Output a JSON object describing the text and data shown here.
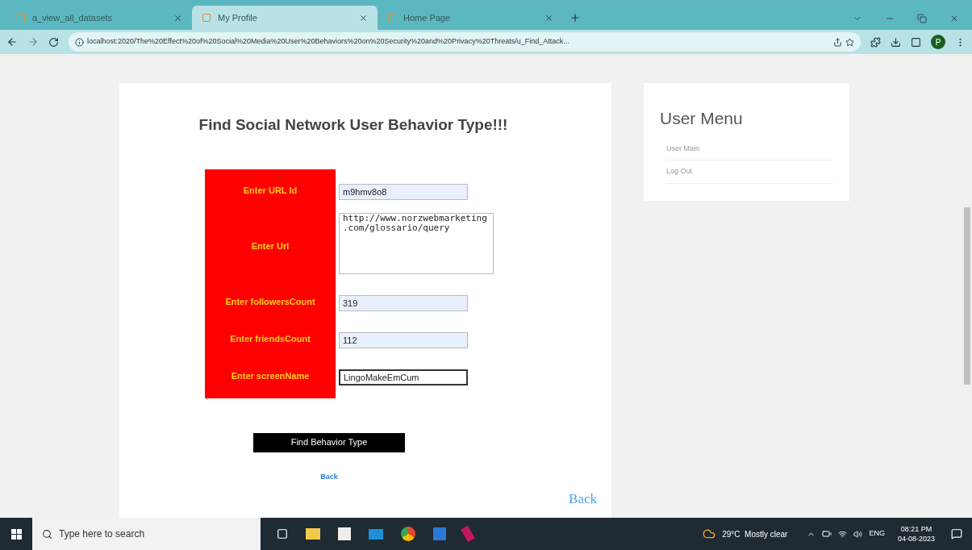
{
  "browser": {
    "tabs": [
      {
        "title": "a_view_all_datasets",
        "selected": false
      },
      {
        "title": "My Profile",
        "selected": true
      },
      {
        "title": "Home Page",
        "selected": false
      }
    ],
    "address": "localhost:2020/The%20Effect%20of%20Social%20Media%20User%20Behaviors%20on%20Security%20and%20Privacy%20Threats/u_Find_Attack...",
    "profile_initial": "P"
  },
  "form": {
    "title": "Find Social Network User Behavior Type!!!",
    "fields": [
      {
        "label": "Enter URL Id",
        "kind": "input",
        "value": "m9hmv8o8",
        "focused": false
      },
      {
        "label": "Enter Url",
        "kind": "textarea",
        "value": "http://www.norzwebmarketing.com/glossario/query",
        "focused": false
      },
      {
        "label": "Enter followersCount",
        "kind": "input",
        "value": "319",
        "focused": false
      },
      {
        "label": "Enter friendsCount",
        "kind": "input",
        "value": "112",
        "focused": false
      },
      {
        "label": "Enter screenName",
        "kind": "input",
        "value": "LingoMakeEmCum",
        "focused": true
      }
    ],
    "submit": "Find Behavior Type",
    "back_small": "Back",
    "back_large": "Back"
  },
  "user_menu": {
    "title": "User Menu",
    "items": [
      "User Main",
      "Log Out"
    ]
  },
  "taskbar": {
    "search_placeholder": "Type here to search",
    "weather": "29°C  Mostly clear",
    "language": "ENG",
    "time": "08:21 PM",
    "date": "04-08-2023"
  }
}
